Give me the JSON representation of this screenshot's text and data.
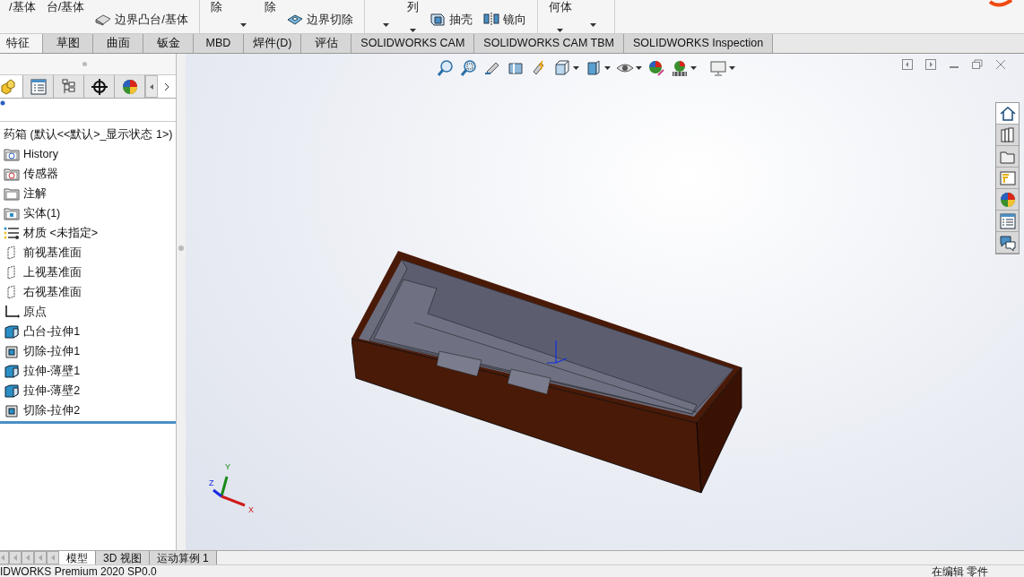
{
  "ribbon": {
    "groups": [
      {
        "items": [
          {
            "kind": "label",
            "label": "/基体"
          },
          {
            "kind": "label",
            "label": "台/基体"
          },
          {
            "kind": "tool",
            "label": "边界凸台/基体"
          }
        ]
      },
      {
        "items": [
          {
            "kind": "label",
            "label": "除"
          },
          {
            "kind": "dropdown"
          },
          {
            "kind": "label",
            "label": "除"
          },
          {
            "kind": "tool",
            "label": "边界切除"
          }
        ]
      },
      {
        "items": [
          {
            "kind": "dropdown"
          },
          {
            "kind": "label",
            "label": "列",
            "dropdown": true
          },
          {
            "kind": "tool",
            "label": "抽壳"
          },
          {
            "kind": "tool",
            "label": "镜向"
          }
        ]
      },
      {
        "items": [
          {
            "kind": "label",
            "label": "何体",
            "dropdown": true
          },
          {
            "kind": "dropdown"
          }
        ]
      }
    ]
  },
  "command_tabs": [
    {
      "label": "特征",
      "selected": true
    },
    {
      "label": "草图",
      "selected": false
    },
    {
      "label": "曲面",
      "selected": false
    },
    {
      "label": "钣金",
      "selected": false
    },
    {
      "label": "MBD",
      "selected": false
    },
    {
      "label": "焊件(D)",
      "selected": false
    },
    {
      "label": "评估",
      "selected": false
    },
    {
      "label": "SOLIDWORKS CAM",
      "selected": false
    },
    {
      "label": "SOLIDWORKS CAM TBM",
      "selected": false
    },
    {
      "label": "SOLIDWORKS Inspection",
      "selected": false
    }
  ],
  "feature_manager": {
    "panel_tabs": [
      {
        "kind": "feature",
        "selected": true
      },
      {
        "kind": "property",
        "selected": false
      },
      {
        "kind": "config",
        "selected": false
      },
      {
        "kind": "dimxpert",
        "selected": false
      },
      {
        "kind": "display",
        "selected": false
      }
    ],
    "part_name": "药箱  (默认<<默认>_显示状态 1>)",
    "tree": [
      {
        "kind": "history",
        "label": "History"
      },
      {
        "kind": "sensor",
        "label": "传感器"
      },
      {
        "kind": "annotation",
        "label": "注解"
      },
      {
        "kind": "body",
        "label": "实体(1)"
      },
      {
        "kind": "material",
        "label": "材质 <未指定>"
      },
      {
        "kind": "plane",
        "label": "前视基准面"
      },
      {
        "kind": "plane",
        "label": "上视基准面"
      },
      {
        "kind": "plane",
        "label": "右视基准面"
      },
      {
        "kind": "origin",
        "label": "原点"
      },
      {
        "kind": "boss",
        "label": "凸台-拉伸1"
      },
      {
        "kind": "cut",
        "label": "切除-拉伸1"
      },
      {
        "kind": "boss",
        "label": "拉伸-薄壁1"
      },
      {
        "kind": "boss",
        "label": "拉伸-薄壁2"
      },
      {
        "kind": "cut",
        "label": "切除-拉伸2"
      }
    ]
  },
  "task_pane": [
    {
      "selected": true
    },
    {
      "selected": false
    },
    {
      "selected": false
    },
    {
      "selected": false
    },
    {
      "selected": false
    },
    {
      "selected": false
    },
    {
      "selected": false
    }
  ],
  "triad": {
    "y": "Y",
    "z": "Z",
    "x": "X"
  },
  "bottom_tabs": [
    {
      "label": "模型",
      "selected": true
    },
    {
      "label": "3D 视图",
      "selected": false
    },
    {
      "label": "运动算例 1",
      "selected": false
    }
  ],
  "status_bar": {
    "left": "IDWORKS Premium 2020 SP0.0",
    "right": "在编辑 零件"
  }
}
